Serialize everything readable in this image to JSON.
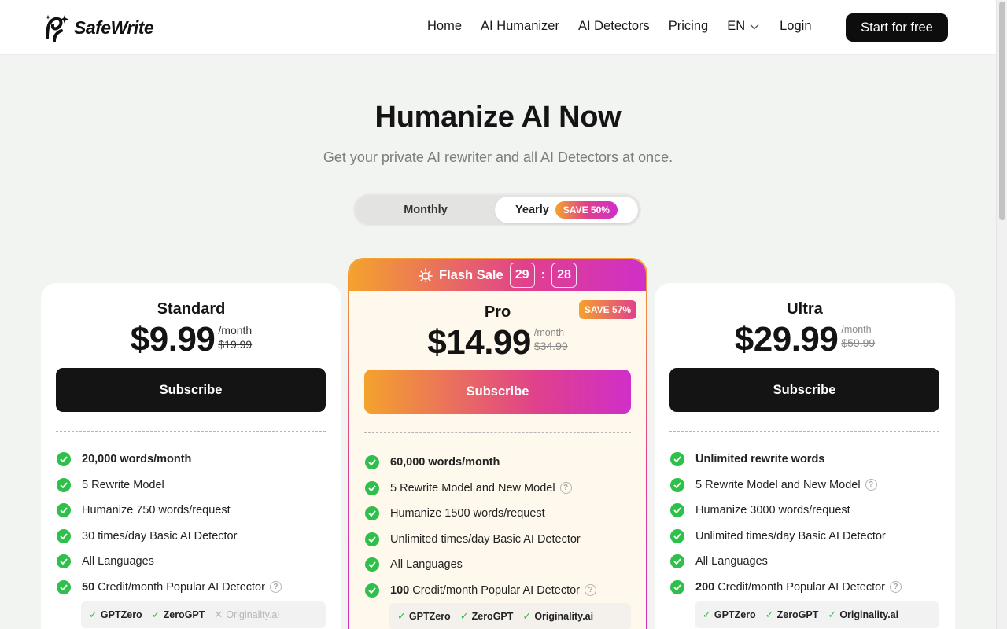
{
  "brand": {
    "name": "SafeWrite"
  },
  "nav": {
    "items": [
      "Home",
      "AI Humanizer",
      "AI Detectors",
      "Pricing"
    ],
    "lang": "EN",
    "login": "Login",
    "cta": "Start for free"
  },
  "hero": {
    "title": "Humanize AI Now",
    "subtitle": "Get your private AI rewriter and all AI Detectors at once."
  },
  "billing": {
    "monthly": "Monthly",
    "yearly": "Yearly",
    "yearly_badge": "SAVE 50%",
    "selected": "Yearly"
  },
  "flash": {
    "label": "Flash Sale",
    "minutes": "29",
    "seconds": "28"
  },
  "plans": [
    {
      "name": "Standard",
      "price": "$9.99",
      "period": "/month",
      "old_price": "$19.99",
      "button": "Subscribe",
      "features": [
        {
          "bold": "20,000 words/month",
          "text": ""
        },
        {
          "bold": "",
          "text": "5 Rewrite Model"
        },
        {
          "bold": "",
          "text": "Humanize 750 words/request"
        },
        {
          "bold": "",
          "text": "30 times/day Basic AI Detector"
        },
        {
          "bold": "",
          "text": "All Languages"
        },
        {
          "bold": "50",
          "text": " Credit/month Popular AI Detector"
        }
      ],
      "detectors": [
        {
          "name": "GPTZero",
          "included": true
        },
        {
          "name": "ZeroGPT",
          "included": true
        },
        {
          "name": "Originality.ai",
          "included": false
        }
      ]
    },
    {
      "name": "Pro",
      "price": "$14.99",
      "period": "/month",
      "old_price": "$34.99",
      "badge": "SAVE 57%",
      "button": "Subscribe",
      "features": [
        {
          "bold": "60,000 words/month",
          "text": ""
        },
        {
          "bold": "",
          "text": "5 Rewrite Model and New Model"
        },
        {
          "bold": "",
          "text": "Humanize 1500 words/request"
        },
        {
          "bold": "",
          "text": "Unlimited times/day Basic AI Detector"
        },
        {
          "bold": "",
          "text": "All Languages"
        },
        {
          "bold": "100",
          "text": " Credit/month Popular AI Detector"
        }
      ],
      "detectors": [
        {
          "name": "GPTZero",
          "included": true
        },
        {
          "name": "ZeroGPT",
          "included": true
        },
        {
          "name": "Originality.ai",
          "included": true
        }
      ]
    },
    {
      "name": "Ultra",
      "price": "$29.99",
      "period": "/month",
      "old_price": "$59.99",
      "button": "Subscribe",
      "features": [
        {
          "bold": "Unlimited rewrite words",
          "text": ""
        },
        {
          "bold": "",
          "text": "5 Rewrite Model and New Model"
        },
        {
          "bold": "",
          "text": "Humanize 3000 words/request"
        },
        {
          "bold": "",
          "text": "Unlimited times/day Basic AI Detector"
        },
        {
          "bold": "",
          "text": "All Languages"
        },
        {
          "bold": "200",
          "text": " Credit/month Popular AI Detector"
        }
      ],
      "detectors": [
        {
          "name": "GPTZero",
          "included": true
        },
        {
          "name": "ZeroGPT",
          "included": true
        },
        {
          "name": "Originality.ai",
          "included": true
        }
      ]
    }
  ],
  "colors": {
    "accent_gradient": [
      "#f4a22d",
      "#e0408c",
      "#cf2fc8"
    ],
    "check": "#2ec04a",
    "dark": "#141414"
  }
}
